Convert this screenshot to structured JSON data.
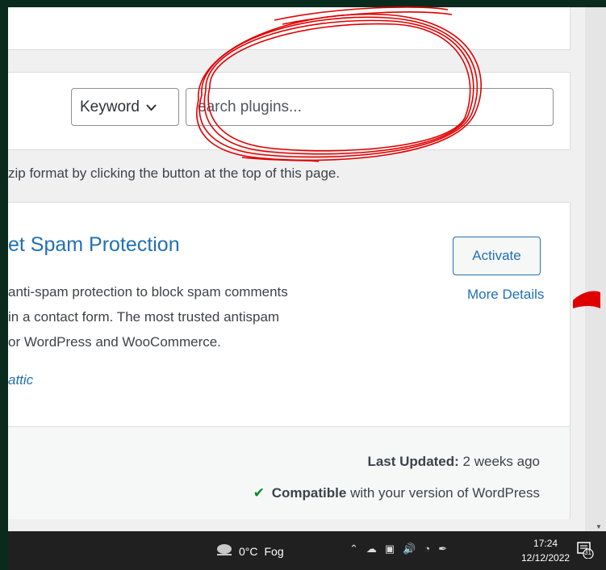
{
  "search": {
    "type_value": "Keyword",
    "placeholder": "earch plugins..."
  },
  "upload_note": "zip format by clicking the button at the top of this page.",
  "plugin": {
    "title": "et Spam Protection",
    "description": [
      "anti-spam protection to block spam comments",
      "in a contact form. The most trusted antispam",
      "or WordPress and WooCommerce."
    ],
    "author": "attic",
    "activate_label": "Activate",
    "more_details_label": "More Details",
    "last_updated_label": "Last Updated:",
    "last_updated_value": "2 weeks ago",
    "compat_strong": "Compatible",
    "compat_text": "with your version of WordPress"
  },
  "taskbar": {
    "temperature": "0°C",
    "weather": "Fog",
    "time": "17:24",
    "date": "12/12/2022",
    "notification_count": "31"
  },
  "colors": {
    "link": "#2271b1",
    "check": "#008a20",
    "annotation": "#e00000"
  }
}
